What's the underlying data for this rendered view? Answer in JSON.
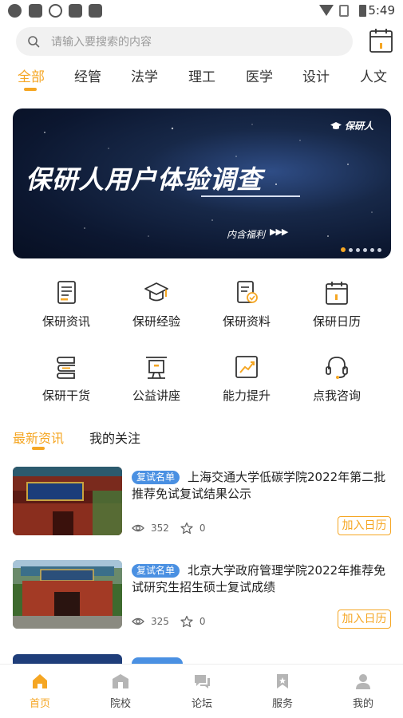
{
  "status_bar": {
    "time": "5:49"
  },
  "search": {
    "placeholder": "请输入要搜索的内容"
  },
  "tabs": [
    "全部",
    "经管",
    "法学",
    "理工",
    "医学",
    "设计",
    "人文"
  ],
  "banner": {
    "logo": "保研人",
    "title": "保研人用户体验调查",
    "subtitle": "内含福利",
    "arrows": "▶▶▶"
  },
  "grid": [
    {
      "label": "保研资讯",
      "icon": "news-doc-icon"
    },
    {
      "label": "保研经验",
      "icon": "grad-cap-icon"
    },
    {
      "label": "保研资料",
      "icon": "docs-check-icon"
    },
    {
      "label": "保研日历",
      "icon": "calendar-icon"
    },
    {
      "label": "保研干货",
      "icon": "stack-icon"
    },
    {
      "label": "公益讲座",
      "icon": "podium-icon"
    },
    {
      "label": "能力提升",
      "icon": "chart-up-icon"
    },
    {
      "label": "点我咨询",
      "icon": "headset-icon"
    }
  ],
  "section_tabs": [
    "最新资讯",
    "我的关注"
  ],
  "news": [
    {
      "badge": "复试名单",
      "title": "上海交通大学低碳学院2022年第二批推荐免试复试结果公示",
      "views": "352",
      "favorites": "0",
      "action": "加入日历"
    },
    {
      "badge": "复试名单",
      "title": "北京大学政府管理学院2022年推荐免试研究生招生硕士复试成绩",
      "views": "325",
      "favorites": "0",
      "action": "加入日历"
    }
  ],
  "bottom_nav": [
    "首页",
    "院校",
    "论坛",
    "服务",
    "我的"
  ],
  "colors": {
    "accent": "#f5a623",
    "badge": "#4a90e2"
  }
}
